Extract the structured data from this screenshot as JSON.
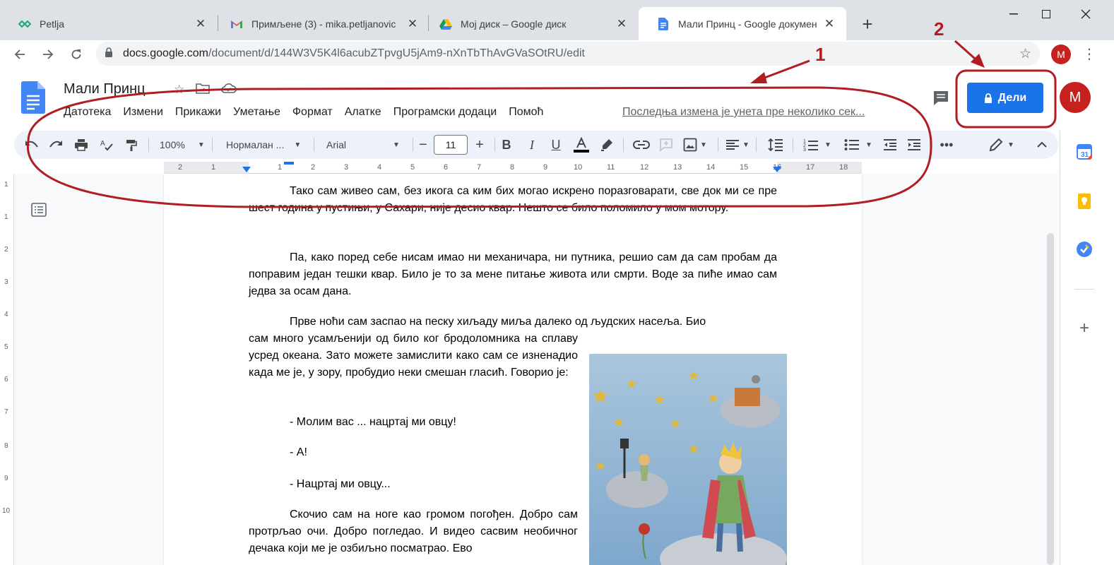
{
  "browser": {
    "tabs": [
      {
        "title": "Petlja",
        "icon": "petlja-icon"
      },
      {
        "title": "Примљене (3) - mika.petljanovic",
        "icon": "gmail-icon"
      },
      {
        "title": "Мој диск – Google диск",
        "icon": "drive-icon"
      },
      {
        "title": "Мали Принц - Google документ",
        "icon": "docs-icon"
      }
    ],
    "url_host": "docs.google.com",
    "url_path": "/document/d/144W3V5K4l6acubZTpvgU5jAm9-nXnTbThAvGVaSOtRU/edit",
    "profile_initial": "M"
  },
  "docs": {
    "title": "Мали Принц",
    "menu": [
      "Датотека",
      "Измени",
      "Прикажи",
      "Уметање",
      "Формат",
      "Алатке",
      "Програмски додаци",
      "Помоћ"
    ],
    "last_edit": "Последња измена је унета пре неколико сек...",
    "share_label": "Дели",
    "avatar_initial": "M",
    "accent_color": "#1a73e8"
  },
  "toolbar": {
    "zoom": "100%",
    "style": "Нормалан ...",
    "font": "Arial",
    "font_size": "11"
  },
  "ruler": {
    "numbers": [
      "2",
      "1",
      "1",
      "2",
      "3",
      "4",
      "5",
      "6",
      "7",
      "8",
      "9",
      "10",
      "11",
      "12",
      "13",
      "14",
      "15",
      "16",
      "17",
      "18"
    ]
  },
  "vruler": {
    "numbers": [
      "1",
      "1",
      "2",
      "3",
      "4",
      "5",
      "6",
      "7",
      "8",
      "9",
      "10"
    ]
  },
  "document": {
    "p1": "Тако сам живео сам, без икога са ким бих могао искрено поразговарати, све док ми се пре шест година у пустињи, у Сахари, није десио квар. Нешто се било поломило у мом мотору.",
    "p2": "Па, како поред себе нисам имао ни механичара, ни путника, решио сам да сам пробам да поправим један тешки квар. Било је то за мене питање живота или смрти. Воде за пиће имао сам једва за осам дана.",
    "p3a": "Прве ноћи сам заспао на песку хиљаду миља далеко од људских насеља. Био",
    "p3b": "сам много усамљенији од било ког бродоломника на сплаву усред океана. Зато можете замислити како сам се изненадио када ме је, у зору, пробудио неки смешан гласић. Говорио је:",
    "d1": "- Молим вас ... нацртај ми овцу!",
    "d2": "- А!",
    "d3": "- Нацртај ми овцу...",
    "p4": "Скочио сам на ноге као громом погођен. Добро сам протрљао очи. Добро погледао. И видео сасвим необичног дечака који ме је озбиљно посматрао. Ево"
  },
  "annotations": {
    "label_1": "1",
    "label_2": "2",
    "color": "#b01e23"
  }
}
